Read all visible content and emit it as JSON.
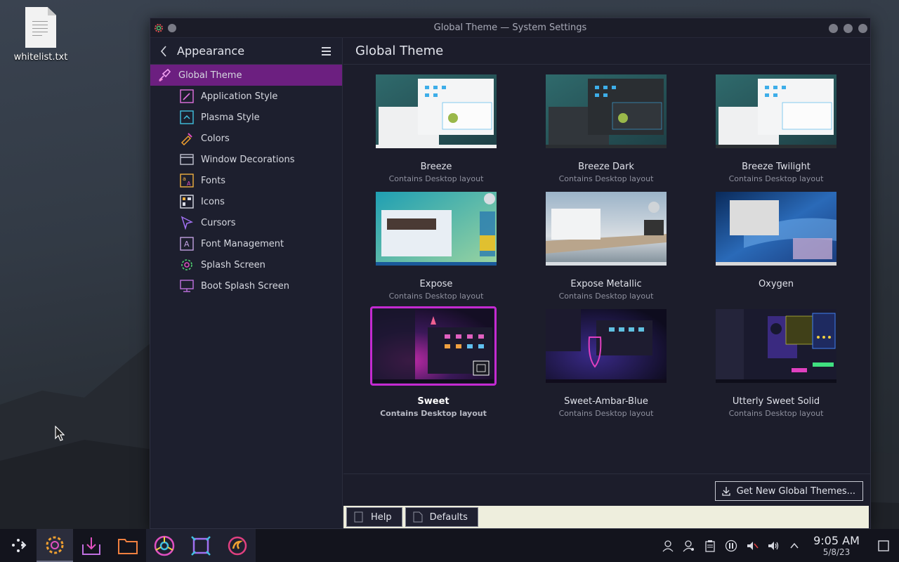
{
  "desktop": {
    "file_label": "whitelist.txt"
  },
  "window": {
    "title": "Global Theme — System Settings"
  },
  "sidebar": {
    "heading": "Appearance",
    "items": [
      {
        "label": "Global Theme",
        "icon": "paintbrush-icon",
        "active": true
      },
      {
        "label": "Application Style",
        "icon": "application-style-icon"
      },
      {
        "label": "Plasma Style",
        "icon": "plasma-style-icon"
      },
      {
        "label": "Colors",
        "icon": "colors-icon"
      },
      {
        "label": "Window Decorations",
        "icon": "window-decorations-icon"
      },
      {
        "label": "Fonts",
        "icon": "fonts-icon"
      },
      {
        "label": "Icons",
        "icon": "icons-icon"
      },
      {
        "label": "Cursors",
        "icon": "cursor-icon"
      },
      {
        "label": "Font Management",
        "icon": "font-management-icon"
      },
      {
        "label": "Splash Screen",
        "icon": "splash-screen-icon"
      },
      {
        "label": "Boot Splash Screen",
        "icon": "boot-splash-icon"
      }
    ]
  },
  "main": {
    "heading": "Global Theme",
    "themes": [
      {
        "name": "Breeze",
        "desc": "Contains Desktop layout"
      },
      {
        "name": "Breeze Dark",
        "desc": "Contains Desktop layout"
      },
      {
        "name": "Breeze Twilight",
        "desc": "Contains Desktop layout"
      },
      {
        "name": "Expose",
        "desc": "Contains Desktop layout"
      },
      {
        "name": "Expose Metallic",
        "desc": "Contains Desktop layout"
      },
      {
        "name": "Oxygen",
        "desc": ""
      },
      {
        "name": "Sweet",
        "desc": "Contains Desktop layout",
        "selected": true
      },
      {
        "name": "Sweet-Ambar-Blue",
        "desc": "Contains Desktop layout"
      },
      {
        "name": "Utterly Sweet Solid",
        "desc": "Contains Desktop layout"
      }
    ],
    "get_new_label": "Get New Global Themes..."
  },
  "buttons": {
    "help": "Help",
    "defaults": "Defaults"
  },
  "taskbar": {
    "time": "9:05 AM",
    "date": "5/8/23"
  },
  "colors": {
    "accent": "#6c1f80",
    "selection_border": "#c42ad2"
  }
}
